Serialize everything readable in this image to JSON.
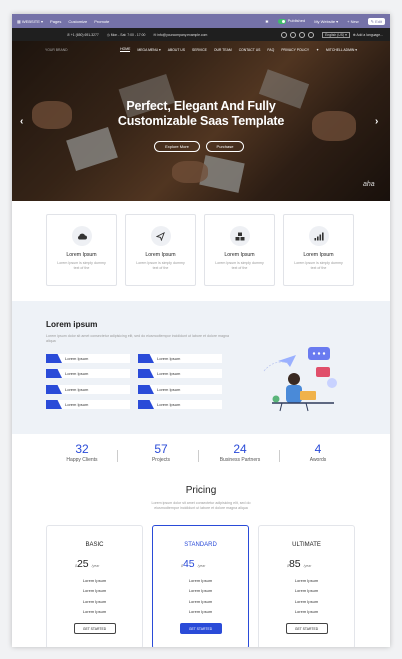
{
  "admin_bar": {
    "menu_label": "WEBSITE",
    "items": [
      "Pages",
      "Customize",
      "Promote"
    ],
    "published": "Published",
    "site": "My Website",
    "new": "+ New",
    "edit": "Edit"
  },
  "top_bar": {
    "phone": "+1 (650) 691-3277",
    "hours": "Mon - Sat: 7:00 - 17:00",
    "email": "info@yourcompany.example.com",
    "language": "English (US)",
    "add_language": "Add a language..."
  },
  "nav": {
    "logo": "YOUR BRAND",
    "links": [
      "HOME",
      "MEGA MENU",
      "ABOUT US",
      "SERVICE",
      "OUR TEAM",
      "CONTACT US",
      "FAQ",
      "PRIVACY POLICY"
    ],
    "user": "MITCHELL ADMIN"
  },
  "hero": {
    "title_line1": "Perfect, Elegant And Fully",
    "title_line2": "Customizable Saas Template",
    "btn_primary": "Explore More",
    "btn_secondary": "Purchase",
    "signature": "aha"
  },
  "services": [
    {
      "icon": "cloud-icon",
      "title": "Lorem Ipsum",
      "desc": "Lorem Ipsum is simply dummy text of the"
    },
    {
      "icon": "paper-plane-icon",
      "title": "Lorem Ipsum",
      "desc": "Lorem Ipsum is simply dummy text of the"
    },
    {
      "icon": "cubes-icon",
      "title": "Lorem Ipsum",
      "desc": "Lorem Ipsum is simply dummy text of the"
    },
    {
      "icon": "signal-icon",
      "title": "Lorem Ipsum",
      "desc": "Lorem Ipsum is simply dummy text of the"
    }
  ],
  "about": {
    "title": "Lorem ipsum",
    "desc": "Lorem ipsum dolor sit amet consectetur adipisicing elit, sed do eiusmodtempor incididunt ut labore et dolore magna aliqua",
    "items": [
      "Lorem Ipsum",
      "Lorem Ipsum",
      "Lorem Ipsum",
      "Lorem Ipsum",
      "Lorem Ipsum",
      "Lorem Ipsum",
      "Lorem Ipsum",
      "Lorem Ipsum"
    ]
  },
  "stats": [
    {
      "num": "32",
      "label": "Happy Clients"
    },
    {
      "num": "57",
      "label": "Projects"
    },
    {
      "num": "24",
      "label": "Business Partners"
    },
    {
      "num": "4",
      "label": "Awords"
    }
  ],
  "pricing": {
    "title": "Pricing",
    "desc": "Lorem ipsum dolor sit amet consectetur adipisicing elit, sed do eiusmodtempor incididunt ut labore et dolore magna aliqua",
    "plans": [
      {
        "name": "BASIC",
        "currency": "$",
        "price": "25",
        "per": "/year",
        "features": [
          "Lorem Ipsum",
          "Lorem Ipsum",
          "Lorem Ipsum",
          "Lorem Ipsum"
        ],
        "cta": "GET STARTED"
      },
      {
        "name": "STANDARD",
        "currency": "$",
        "price": "45",
        "per": "/year",
        "features": [
          "Lorem Ipsum",
          "Lorem Ipsum",
          "Lorem Ipsum",
          "Lorem Ipsum"
        ],
        "cta": "GET STARTED"
      },
      {
        "name": "ULTIMATE",
        "currency": "$",
        "price": "85",
        "per": "/year",
        "features": [
          "Lorem Ipsum",
          "Lorem Ipsum",
          "Lorem Ipsum",
          "Lorem Ipsum"
        ],
        "cta": "GET STARTED"
      }
    ]
  },
  "colors": {
    "accent": "#2a4bd8",
    "admin_bar": "#7572a8",
    "section_bg": "#eef2f7"
  }
}
